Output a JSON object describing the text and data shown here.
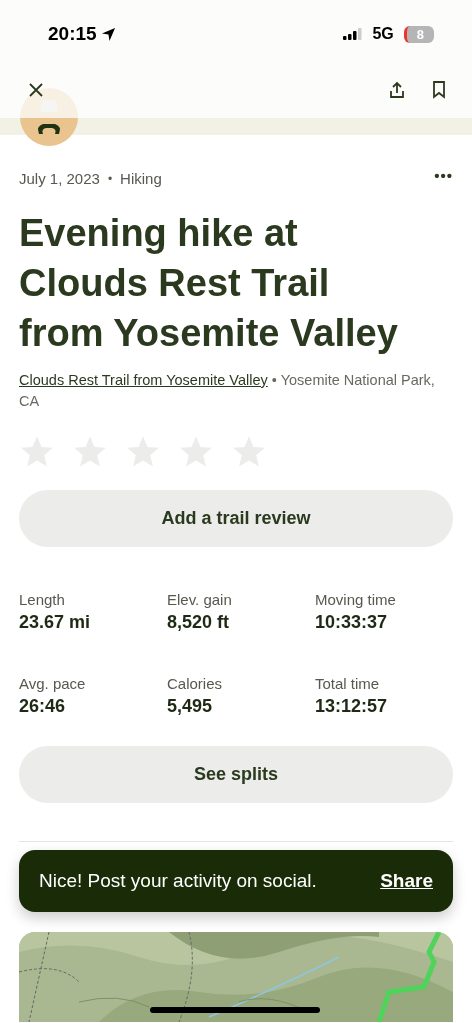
{
  "status_bar": {
    "time": "20:15",
    "network": "5G",
    "battery": "8"
  },
  "meta": {
    "date": "July 1, 2023",
    "separator": "•",
    "activity": "Hiking",
    "more": "•••"
  },
  "title": "Evening hike at Clouds Rest Trail from Yosemite Valley",
  "trail": {
    "name": "Clouds Rest Trail from Yosemite Valley",
    "separator": "•",
    "location": "Yosemite National Park, CA"
  },
  "rating": {
    "stars": 0
  },
  "review_button": "Add a trail review",
  "stats": [
    {
      "label": "Length",
      "value": "23.67 mi"
    },
    {
      "label": "Elev. gain",
      "value": "8,520 ft"
    },
    {
      "label": "Moving time",
      "value": "10:33:37"
    },
    {
      "label": "Avg. pace",
      "value": "26:46"
    },
    {
      "label": "Calories",
      "value": "5,495"
    },
    {
      "label": "Total time",
      "value": "13:12:57"
    }
  ],
  "splits_button": "See splits",
  "toast": {
    "message": "Nice! Post your activity on social.",
    "action": "Share"
  }
}
